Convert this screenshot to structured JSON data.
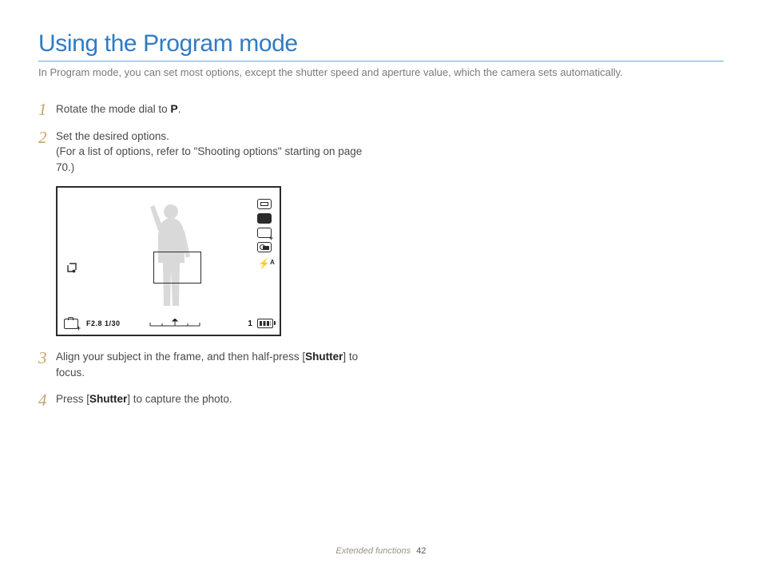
{
  "title": "Using the Program mode",
  "intro": "In Program mode, you can set most options, except the shutter speed and aperture value, which the camera sets automatically.",
  "steps": {
    "s1_before": "Rotate the mode dial to ",
    "s1_icon": "P",
    "s1_after": ".",
    "s2_line1": "Set the desired options.",
    "s2_line2": "(For a list of options, refer to \"Shooting options\" starting on page 70.)",
    "s3_before": "Align your subject in the frame, and then half-press [",
    "s3_bold": "Shutter",
    "s3_after": "] to focus.",
    "s4_before": "Press [",
    "s4_bold": "Shutter",
    "s4_after": "] to capture the photo."
  },
  "nums": {
    "n1": "1",
    "n2": "2",
    "n3": "3",
    "n4": "4"
  },
  "screen": {
    "flash_auto": "⚡ᴬ",
    "exposure": "F2.8 1/30",
    "one": "1"
  },
  "footer": {
    "section": "Extended functions",
    "page": "42"
  }
}
